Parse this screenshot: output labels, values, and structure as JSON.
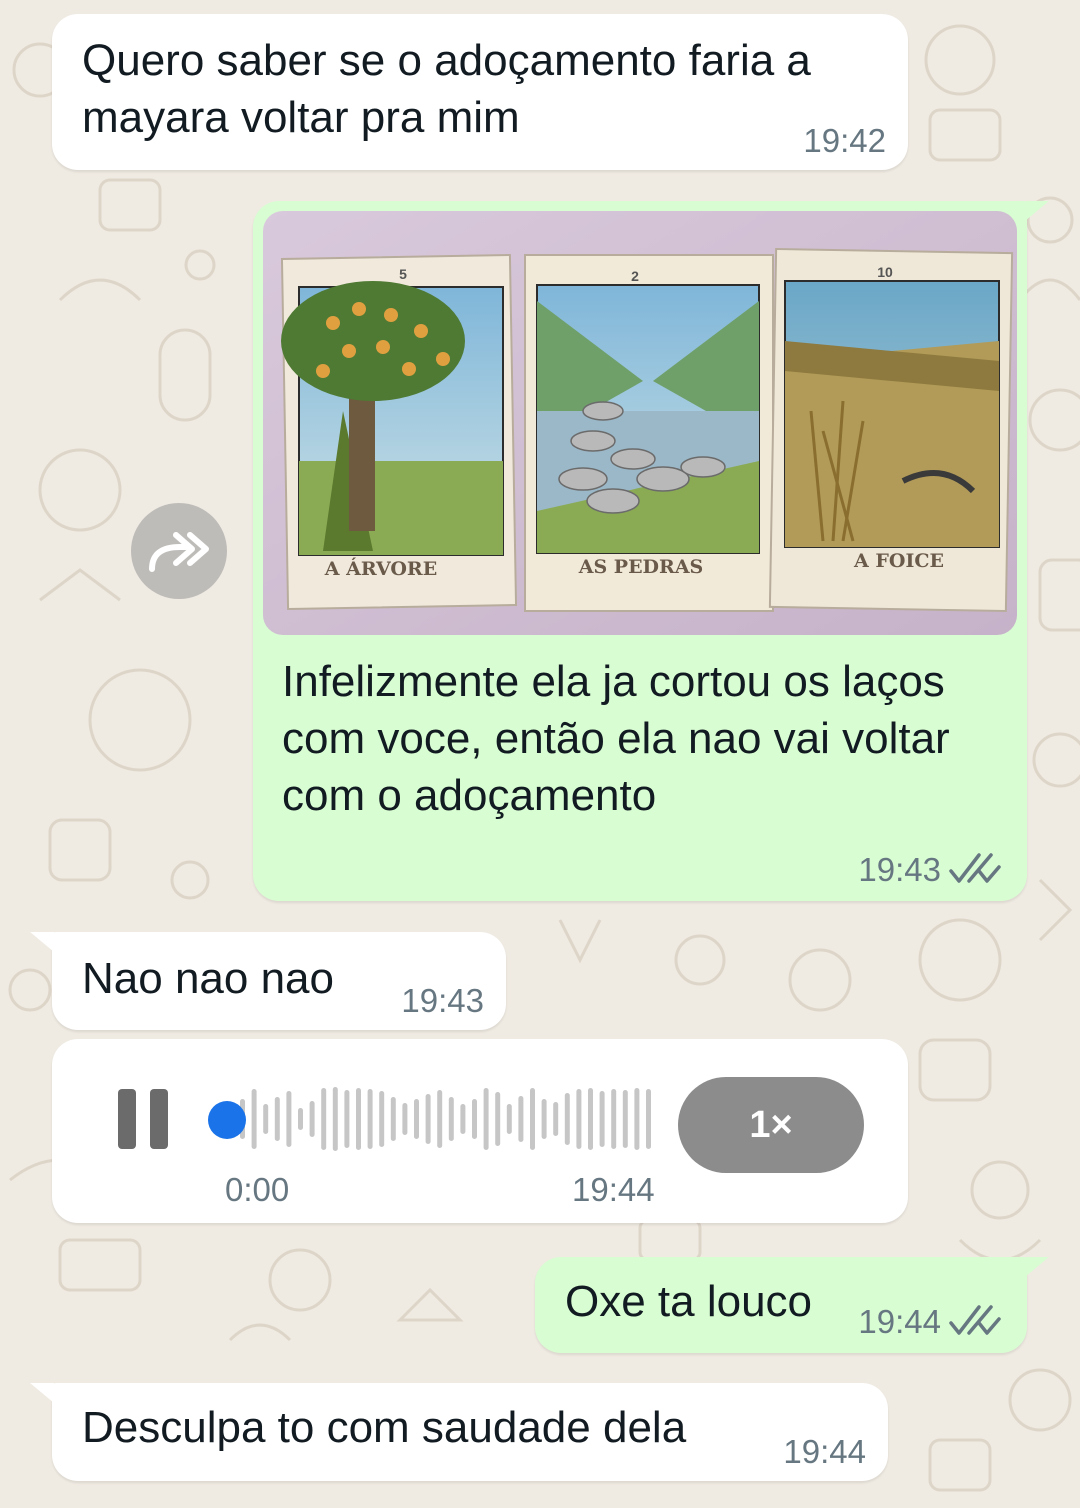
{
  "messages": [
    {
      "direction": "incoming",
      "text": "Quero saber se o adoçamento faria a mayara voltar pra mim",
      "time": "19:42"
    },
    {
      "direction": "outgoing",
      "image": {
        "cards": [
          {
            "number": "5",
            "title": "A ÁRVORE"
          },
          {
            "number": "2",
            "title": "AS PEDRAS"
          },
          {
            "number": "10",
            "title": "A FOICE"
          }
        ]
      },
      "text": "Infelizmente ela ja cortou os laços com voce, então ela nao vai voltar com o adoçamento",
      "time": "19:43",
      "status": "read"
    },
    {
      "direction": "incoming",
      "text": "Nao nao nao",
      "time": "19:43"
    },
    {
      "direction": "incoming",
      "type": "voice",
      "elapsed": "0:00",
      "time": "19:44",
      "speed": "1×",
      "state": "playing",
      "progress": 0
    },
    {
      "direction": "outgoing",
      "text": "Oxe ta louco",
      "time": "19:44",
      "status": "read"
    },
    {
      "direction": "incoming",
      "text": "Desculpa to com saudade dela",
      "time": "19:44"
    }
  ],
  "icons": {
    "forward": "forward-icon",
    "pause": "pause-icon",
    "read_ticks": "double-check-icon"
  },
  "colors": {
    "background": "#efeae2",
    "incoming_bubble": "#ffffff",
    "outgoing_bubble": "#d9fdd3",
    "read_ticks": "#667781",
    "audio_progress": "#1a73e8"
  }
}
